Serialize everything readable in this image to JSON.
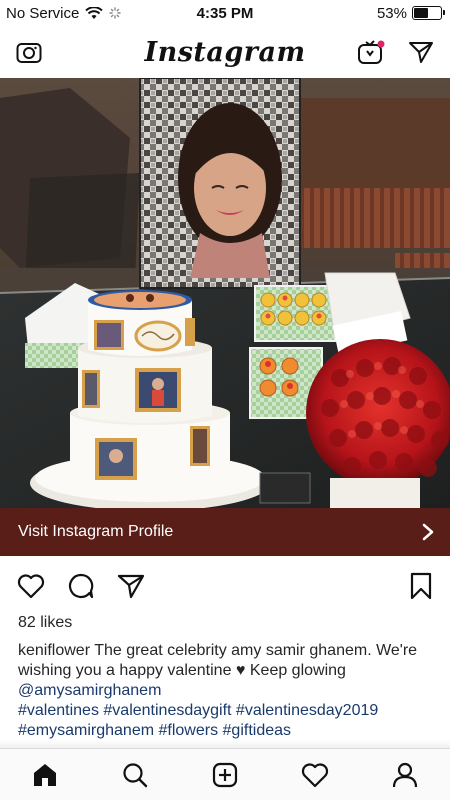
{
  "status_bar": {
    "carrier": "No Service",
    "time": "4:35 PM",
    "battery_percent": "53%",
    "battery_level": 0.53
  },
  "header": {
    "brand": "Instagram",
    "left_icon": "camera-icon",
    "right_icons": [
      "igtv-icon",
      "direct-message-icon"
    ]
  },
  "post": {
    "visit_profile_label": "Visit Instagram Profile",
    "likes": "82 likes",
    "username": "keniflower",
    "caption_text": "The great celebrity amy samir ghanem. We're wishing you a happy valentine ♥ Keep glowing",
    "mention": "@amysamirghanem",
    "hashtags_line1": "#valentines #valentinesdaygift #valentinesday2019",
    "hashtags_line2": "#emysamirghanem #flowers #giftideas"
  },
  "bottom_nav": {
    "items": [
      "home-icon",
      "search-icon",
      "new-post-icon",
      "activity-icon",
      "profile-icon"
    ]
  },
  "colors": {
    "visit_bar": "#5a1e18",
    "link": "#1a3a6b",
    "text": "#262626"
  }
}
